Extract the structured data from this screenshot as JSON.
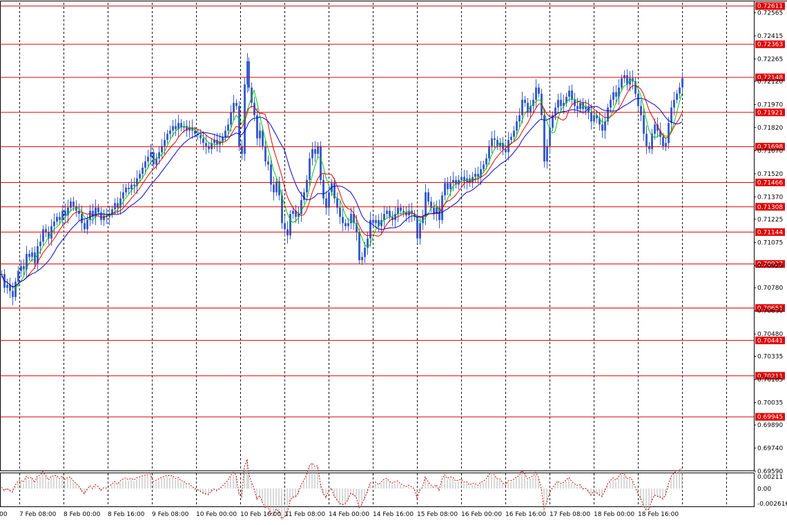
{
  "chart_data": {
    "type": "candlestick",
    "symbol_note": "",
    "colors": {
      "candle": "#3a5fcd",
      "ma_fast": "#00cc00",
      "ma_mid": "#e00000",
      "ma_slow": "#0000cc",
      "level_line": "#e00000",
      "level_label_bg": "#e00000",
      "level_label_text": "#ffffff",
      "grid": "#000000",
      "osc_line": "#c00000",
      "osc_hist": "#b0b0b0"
    },
    "grid": true,
    "price_axis": {
      "min": 0.6959,
      "max": 0.7263,
      "ticks": [
        "0.72565",
        "0.72415",
        "0.72265",
        "0.72120",
        "0.71970",
        "0.71820",
        "0.71670",
        "0.71520",
        "0.71370",
        "0.71225",
        "0.71075",
        "0.70925",
        "0.70780",
        "0.70630",
        "0.70480",
        "0.70335",
        "0.70185",
        "0.70035",
        "0.69890",
        "0.69740",
        "0.69590"
      ]
    },
    "levels": [
      "0.72611",
      "0.72363",
      "0.72148",
      "0.71921",
      "0.71698",
      "0.71466",
      "0.71308",
      "0.71144",
      "0.70937",
      "0.70651",
      "0.70441",
      "0.70211",
      "0.69945"
    ],
    "time_axis": {
      "labels": [
        ":00",
        "7 Feb 08:00",
        "8 Feb 00:00",
        "8 Feb 16:00",
        "9 Feb 08:00",
        "10 Feb 00:00",
        "10 Feb 16:00",
        "11 Feb 08:00",
        "14 Feb 00:00",
        "14 Feb 16:00",
        "15 Feb 08:00",
        "16 Feb 00:00",
        "16 Feb 16:00",
        "17 Feb 08:00",
        "18 Feb 00:00",
        "18 Feb 16:00"
      ]
    },
    "oscillator": {
      "ticks": [
        "0.00211",
        "0.00",
        "-0.002616"
      ],
      "min": -0.00262,
      "max": 0.00211
    },
    "price_path": [
      [
        0,
        0.7087
      ],
      [
        4,
        0.7078
      ],
      [
        8,
        0.708
      ],
      [
        12,
        0.7076
      ],
      [
        16,
        0.7072
      ],
      [
        20,
        0.7082
      ],
      [
        24,
        0.7089
      ],
      [
        28,
        0.7092
      ],
      [
        32,
        0.709
      ],
      [
        36,
        0.71
      ],
      [
        40,
        0.7098
      ],
      [
        44,
        0.7101
      ],
      [
        48,
        0.7094
      ],
      [
        52,
        0.7105
      ],
      [
        56,
        0.7108
      ],
      [
        60,
        0.7116
      ],
      [
        64,
        0.7114
      ],
      [
        68,
        0.711
      ],
      [
        72,
        0.7118
      ],
      [
        76,
        0.7121
      ],
      [
        80,
        0.7124
      ],
      [
        84,
        0.7122
      ],
      [
        88,
        0.7128
      ],
      [
        92,
        0.7125
      ],
      [
        96,
        0.713
      ],
      [
        100,
        0.7134
      ],
      [
        104,
        0.7131
      ],
      [
        108,
        0.7128
      ],
      [
        112,
        0.7126
      ],
      [
        116,
        0.712
      ],
      [
        120,
        0.7116
      ],
      [
        124,
        0.7122
      ],
      [
        128,
        0.7128
      ],
      [
        132,
        0.7124
      ],
      [
        136,
        0.713
      ],
      [
        140,
        0.7127
      ],
      [
        144,
        0.7122
      ],
      [
        148,
        0.7125
      ],
      [
        152,
        0.7124
      ],
      [
        156,
        0.7126
      ],
      [
        160,
        0.7129
      ],
      [
        164,
        0.7133
      ],
      [
        168,
        0.713
      ],
      [
        172,
        0.7136
      ],
      [
        176,
        0.714
      ],
      [
        180,
        0.7143
      ],
      [
        184,
        0.7142
      ],
      [
        188,
        0.7145
      ],
      [
        192,
        0.7144
      ],
      [
        196,
        0.7149
      ],
      [
        200,
        0.7152
      ],
      [
        204,
        0.7156
      ],
      [
        208,
        0.716
      ],
      [
        212,
        0.7163
      ],
      [
        216,
        0.7166
      ],
      [
        220,
        0.7158
      ],
      [
        224,
        0.7162
      ],
      [
        228,
        0.7166
      ],
      [
        232,
        0.717
      ],
      [
        236,
        0.7174
      ],
      [
        240,
        0.7178
      ],
      [
        244,
        0.718
      ],
      [
        248,
        0.7183
      ],
      [
        252,
        0.7181
      ],
      [
        256,
        0.7185
      ],
      [
        260,
        0.7182
      ],
      [
        264,
        0.7183
      ],
      [
        268,
        0.718
      ],
      [
        272,
        0.7182
      ],
      [
        276,
        0.718
      ],
      [
        280,
        0.7178
      ],
      [
        284,
        0.7177
      ],
      [
        288,
        0.7175
      ],
      [
        292,
        0.7172
      ],
      [
        296,
        0.717
      ],
      [
        300,
        0.7168
      ],
      [
        304,
        0.7172
      ],
      [
        308,
        0.7174
      ],
      [
        312,
        0.7171
      ],
      [
        316,
        0.7173
      ],
      [
        320,
        0.7176
      ],
      [
        324,
        0.718
      ],
      [
        328,
        0.7184
      ],
      [
        332,
        0.7192
      ],
      [
        336,
        0.7198
      ],
      [
        340,
        0.7196
      ],
      [
        344,
        0.717
      ],
      [
        348,
        0.7165
      ],
      [
        352,
        0.721
      ],
      [
        356,
        0.7225
      ],
      [
        358,
        0.7208
      ],
      [
        362,
        0.7198
      ],
      [
        366,
        0.719
      ],
      [
        370,
        0.7175
      ],
      [
        374,
        0.718
      ],
      [
        378,
        0.717
      ],
      [
        382,
        0.716
      ],
      [
        386,
        0.7158
      ],
      [
        390,
        0.7145
      ],
      [
        394,
        0.714
      ],
      [
        398,
        0.7147
      ],
      [
        402,
        0.7138
      ],
      [
        406,
        0.712
      ],
      [
        410,
        0.7116
      ],
      [
        414,
        0.7112
      ],
      [
        418,
        0.7126
      ],
      [
        422,
        0.7128
      ],
      [
        426,
        0.7124
      ],
      [
        430,
        0.7126
      ],
      [
        434,
        0.7135
      ],
      [
        438,
        0.714
      ],
      [
        442,
        0.7148
      ],
      [
        446,
        0.7162
      ],
      [
        450,
        0.7168
      ],
      [
        454,
        0.7165
      ],
      [
        458,
        0.717
      ],
      [
        462,
        0.7148
      ],
      [
        466,
        0.7136
      ],
      [
        470,
        0.713
      ],
      [
        474,
        0.714
      ],
      [
        478,
        0.7146
      ],
      [
        482,
        0.7136
      ],
      [
        486,
        0.713
      ],
      [
        490,
        0.7124
      ],
      [
        494,
        0.712
      ],
      [
        498,
        0.7118
      ],
      [
        502,
        0.712
      ],
      [
        506,
        0.7126
      ],
      [
        510,
        0.712
      ],
      [
        514,
        0.7114
      ],
      [
        518,
        0.7096
      ],
      [
        522,
        0.7098
      ],
      [
        526,
        0.7104
      ],
      [
        530,
        0.711
      ],
      [
        534,
        0.7122
      ],
      [
        538,
        0.712
      ],
      [
        542,
        0.7122
      ],
      [
        546,
        0.7118
      ],
      [
        550,
        0.7122
      ],
      [
        554,
        0.7126
      ],
      [
        558,
        0.7128
      ],
      [
        562,
        0.7124
      ],
      [
        566,
        0.7122
      ],
      [
        570,
        0.7126
      ],
      [
        574,
        0.713
      ],
      [
        578,
        0.7128
      ],
      [
        582,
        0.7127
      ],
      [
        586,
        0.7125
      ],
      [
        590,
        0.7128
      ],
      [
        594,
        0.7126
      ],
      [
        598,
        0.7124
      ],
      [
        602,
        0.711
      ],
      [
        606,
        0.712
      ],
      [
        610,
        0.7124
      ],
      [
        614,
        0.714
      ],
      [
        618,
        0.7134
      ],
      [
        622,
        0.713
      ],
      [
        626,
        0.7126
      ],
      [
        630,
        0.713
      ],
      [
        634,
        0.7122
      ],
      [
        638,
        0.7138
      ],
      [
        642,
        0.7146
      ],
      [
        646,
        0.7142
      ],
      [
        650,
        0.7146
      ],
      [
        654,
        0.7148
      ],
      [
        658,
        0.7145
      ],
      [
        662,
        0.7148
      ],
      [
        666,
        0.715
      ],
      [
        670,
        0.7147
      ],
      [
        674,
        0.7149
      ],
      [
        678,
        0.7146
      ],
      [
        682,
        0.715
      ],
      [
        686,
        0.7152
      ],
      [
        690,
        0.715
      ],
      [
        694,
        0.7155
      ],
      [
        698,
        0.7158
      ],
      [
        702,
        0.7162
      ],
      [
        706,
        0.717
      ],
      [
        710,
        0.7175
      ],
      [
        714,
        0.7174
      ],
      [
        718,
        0.717
      ],
      [
        722,
        0.7172
      ],
      [
        726,
        0.7168
      ],
      [
        730,
        0.7166
      ],
      [
        734,
        0.7174
      ],
      [
        738,
        0.7176
      ],
      [
        742,
        0.718
      ],
      [
        746,
        0.7186
      ],
      [
        750,
        0.719
      ],
      [
        754,
        0.72
      ],
      [
        758,
        0.7198
      ],
      [
        762,
        0.7192
      ],
      [
        766,
        0.7196
      ],
      [
        770,
        0.72
      ],
      [
        774,
        0.7208
      ],
      [
        778,
        0.7204
      ],
      [
        782,
        0.719
      ],
      [
        786,
        0.716
      ],
      [
        790,
        0.717
      ],
      [
        794,
        0.7182
      ],
      [
        798,
        0.719
      ],
      [
        802,
        0.7195
      ],
      [
        806,
        0.72
      ],
      [
        810,
        0.7196
      ],
      [
        814,
        0.7198
      ],
      [
        818,
        0.7202
      ],
      [
        822,
        0.7206
      ],
      [
        826,
        0.72
      ],
      [
        830,
        0.7196
      ],
      [
        834,
        0.7194
      ],
      [
        838,
        0.7198
      ],
      [
        842,
        0.7194
      ],
      [
        846,
        0.7196
      ],
      [
        850,
        0.7192
      ],
      [
        854,
        0.7186
      ],
      [
        858,
        0.719
      ],
      [
        862,
        0.7188
      ],
      [
        866,
        0.7184
      ],
      [
        870,
        0.718
      ],
      [
        874,
        0.7186
      ],
      [
        878,
        0.7195
      ],
      [
        882,
        0.72
      ],
      [
        886,
        0.7205
      ],
      [
        890,
        0.7202
      ],
      [
        894,
        0.7208
      ],
      [
        898,
        0.7214
      ],
      [
        902,
        0.7216
      ],
      [
        906,
        0.721
      ],
      [
        910,
        0.7214
      ],
      [
        914,
        0.7212
      ],
      [
        918,
        0.7204
      ],
      [
        922,
        0.7196
      ],
      [
        926,
        0.719
      ],
      [
        930,
        0.7178
      ],
      [
        934,
        0.717
      ],
      [
        938,
        0.7168
      ],
      [
        942,
        0.7178
      ],
      [
        946,
        0.7184
      ],
      [
        950,
        0.718
      ],
      [
        954,
        0.7176
      ],
      [
        958,
        0.717
      ],
      [
        962,
        0.7172
      ],
      [
        966,
        0.7185
      ],
      [
        970,
        0.7195
      ],
      [
        974,
        0.72
      ],
      [
        978,
        0.7204
      ],
      [
        982,
        0.7208
      ],
      [
        986,
        0.7214
      ]
    ]
  }
}
